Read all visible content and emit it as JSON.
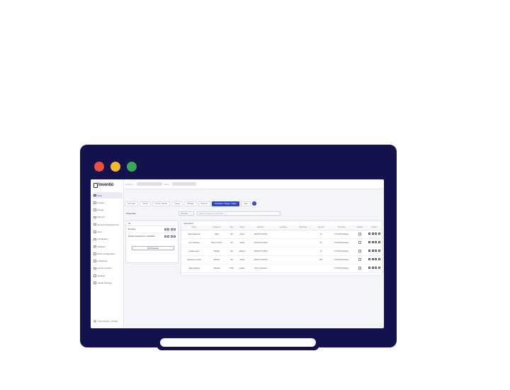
{
  "brand": {
    "name": "Inventio"
  },
  "sidebar": {
    "items": [
      {
        "label": "Flow",
        "active": true
      },
      {
        "label": "Groups"
      },
      {
        "label": "Recap"
      },
      {
        "label": "Reports"
      },
      {
        "label": "Security Requirements"
      },
      {
        "label": "Docs"
      },
      {
        "label": "Certificates"
      },
      {
        "label": "Network"
      },
      {
        "label": "BGP Configuration"
      },
      {
        "label": "Guidelines"
      },
      {
        "label": "Access Control"
      },
      {
        "label": "Auditing"
      },
      {
        "label": "Global Settings"
      }
    ],
    "user": "Scott Wright · Details"
  },
  "topbar": {
    "crumb_a": "Projects ›",
    "crumb_b": "Flow ›"
  },
  "tabs": [
    {
      "label": "Overview"
    },
    {
      "label": "Inputs"
    },
    {
      "label": "Inputs / Details"
    },
    {
      "label": "Usage"
    },
    {
      "label": "Storage"
    },
    {
      "label": "Outputs"
    },
    {
      "label": "Schedule / Trigger / Delay",
      "active": true
    },
    {
      "label": "Tags"
    }
  ],
  "tab_info": "i",
  "filter": {
    "title": "Properties",
    "select_value": "All Fields",
    "search_placeholder": "Search properties or add filter..."
  },
  "left_panel": {
    "title": "All",
    "rows": [
      {
        "label": "Modules"
      },
      {
        "label": "Pipeline Deployment / Variables"
      }
    ],
    "add_button": "Add Schedule"
  },
  "right_panel": {
    "title": "Schedules",
    "columns": [
      "Name",
      "Frequency",
      "Type",
      "Status",
      "Next Run",
      "Last Run",
      "Start Date",
      "Interval",
      "Time Zone",
      "Enabled",
      "Actions"
    ],
    "rows": [
      [
        "daily-backup-01",
        "Daily",
        "Job",
        "Active",
        "2024-06-12 02:00",
        "",
        "",
        "1d",
        "UTC+00:00 Europe",
        "",
        ""
      ],
      [
        "sync-inventory",
        "Every 6 Hours",
        "Job",
        "Active",
        "2024-06-11 18:00",
        "",
        "",
        "6h",
        "UTC+00:00 Europe",
        "",
        ""
      ],
      [
        "weekly-report",
        "Weekly",
        "Job",
        "Paused",
        "2024-06-17 09:00",
        "",
        "",
        "7d",
        "UTC+00:00 Europe",
        "",
        ""
      ],
      [
        "cleanup-temp-files",
        "Monthly",
        "Job",
        "Active",
        "2024-07-01 03:00",
        "",
        "",
        "30d",
        "UTC+00:00 Europe",
        "",
        ""
      ],
      [
        "deploy-staging",
        "Manual",
        "Hook",
        "Ready",
        "Run on demand",
        "",
        "",
        "-",
        "UTC+00:00 Europe",
        "",
        ""
      ]
    ]
  }
}
